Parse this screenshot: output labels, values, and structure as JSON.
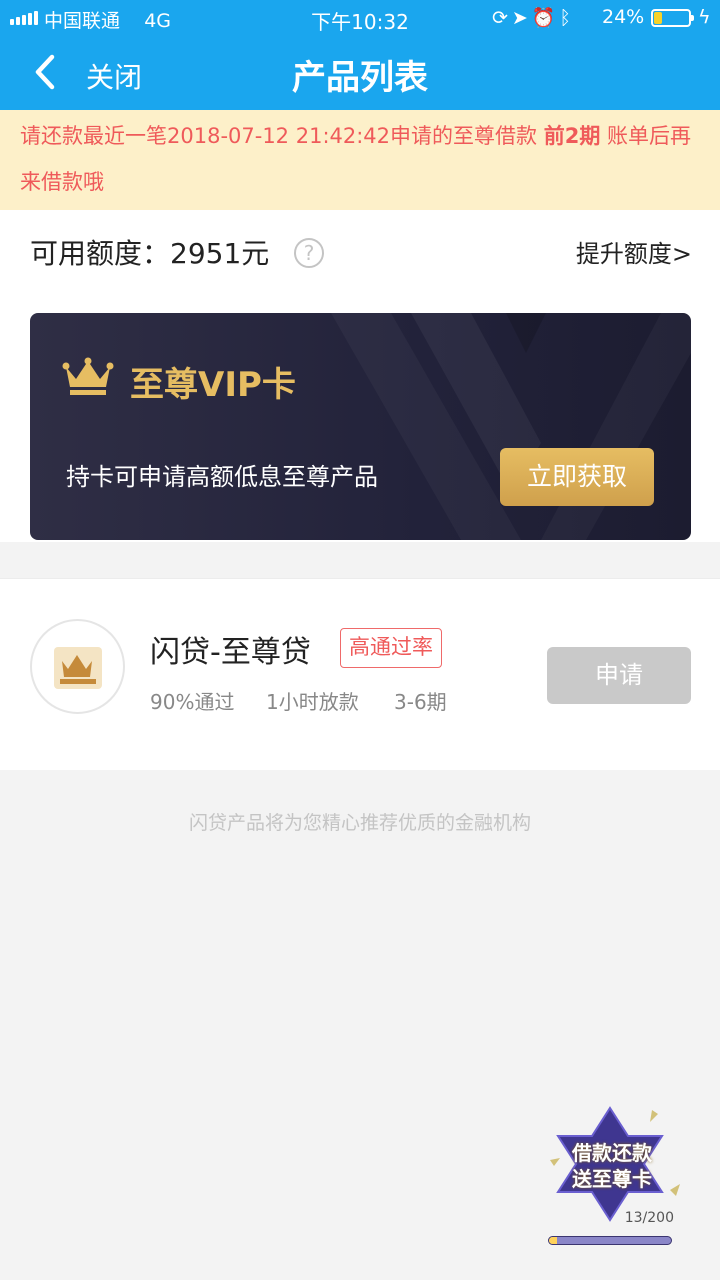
{
  "status_bar": {
    "carrier": "中国联通",
    "network": "4G",
    "time": "下午10:32",
    "battery_percent": "24%",
    "battery_level": 0.24,
    "icons": [
      "signal-icon",
      "orientation-lock-icon",
      "location-icon",
      "alarm-icon",
      "bluetooth-icon",
      "battery-icon",
      "charging-icon"
    ]
  },
  "nav": {
    "close_label": "关闭",
    "title": "产品列表"
  },
  "notice": {
    "text_before": "请还款最近一笔2018-07-12 21:42:42申请的至尊借款 ",
    "highlight": "前2期",
    "text_after": " 账单后再来借款哦"
  },
  "quota": {
    "label": "可用额度：",
    "value": "2951元",
    "help_symbol": "?",
    "raise_label": "提升额度>"
  },
  "vip_card": {
    "title": "至尊VIP卡",
    "description": "持卡可申请高额低息至尊产品",
    "button_label": "立即获取"
  },
  "product": {
    "logo_char": "尊",
    "name": "闪贷-至尊贷",
    "tag": "高通过率",
    "pass_rate": "90%通过",
    "disburse_time": "1小时放款",
    "terms": "3-6期",
    "apply_label": "申请"
  },
  "footer_note": "闪贷产品将为您精心推荐优质的金融机构",
  "promo": {
    "line1": "借款还款",
    "line2": "送至尊卡",
    "count": "13/200",
    "progress": 0.065
  },
  "colors": {
    "brand_blue": "#1aa6ee",
    "notice_bg": "#fdf0c9",
    "notice_text": "#ef5a5a",
    "gold": "#e6bd62",
    "card_dark": "#2a293f",
    "disabled_button": "#c9c9c9"
  }
}
